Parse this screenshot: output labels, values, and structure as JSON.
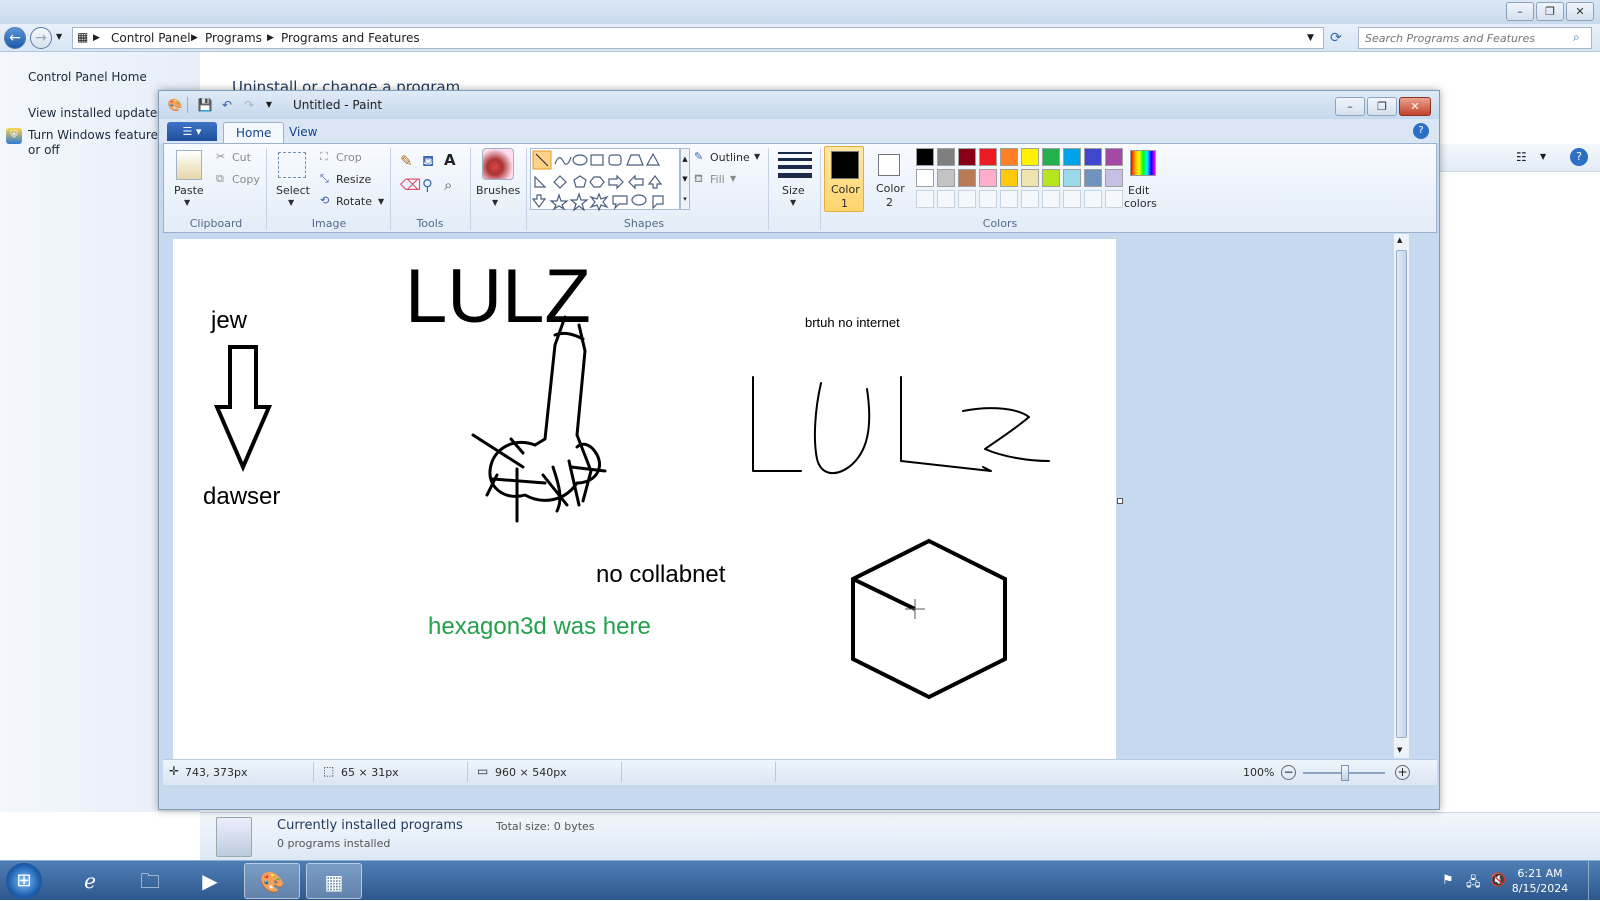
{
  "explorer": {
    "breadcrumb": [
      "Control Panel",
      "Programs",
      "Programs and Features"
    ],
    "search_placeholder": "Search Programs and Features",
    "left_links": [
      "Control Panel Home",
      "View installed updates",
      "Turn Windows features on or off"
    ],
    "main_title": "Uninstall or change a program",
    "status": {
      "title": "Currently installed programs",
      "total_size": "Total size: 0 bytes",
      "count": "0 programs installed"
    }
  },
  "paint": {
    "title": "Untitled - Paint",
    "tabs": [
      "Home",
      "View"
    ],
    "ribbon": {
      "clipboard": {
        "label": "Clipboard",
        "paste": "Paste",
        "cut": "Cut",
        "copy": "Copy"
      },
      "image": {
        "label": "Image",
        "select": "Select",
        "crop": "Crop",
        "resize": "Resize",
        "rotate": "Rotate"
      },
      "tools": {
        "label": "Tools"
      },
      "brushes": "Brushes",
      "shapes": {
        "label": "Shapes",
        "outline": "Outline",
        "fill": "Fill"
      },
      "size": "Size",
      "color1": [
        "Color",
        "1"
      ],
      "color2": [
        "Color",
        "2"
      ],
      "colors_label": "Colors",
      "edit_colors": [
        "Edit",
        "colors"
      ],
      "palette_row1": [
        "#000000",
        "#7f7f7f",
        "#880015",
        "#ed1c24",
        "#ff7f27",
        "#fff200",
        "#22b14c",
        "#00a2e8",
        "#3f48cc",
        "#a349a4"
      ],
      "palette_row2": [
        "#ffffff",
        "#c3c3c3",
        "#b97a57",
        "#ffaec9",
        "#ffc90e",
        "#efe4b0",
        "#b5e61d",
        "#99d9ea",
        "#7092be",
        "#c8bfe7"
      ]
    },
    "canvas_text": {
      "lulz": "LULZ",
      "jew": "jew",
      "dawser": "dawser",
      "brtuh": "brtuh no internet",
      "collabnet": "no collabnet",
      "hexagon": "hexagon3d was here"
    },
    "status": {
      "cursor": "743, 373px",
      "selection": "65 × 31px",
      "canvas_size": "960 × 540px",
      "zoom": "100%"
    }
  },
  "taskbar": {
    "time": "6:21 AM",
    "date": "8/15/2024"
  }
}
